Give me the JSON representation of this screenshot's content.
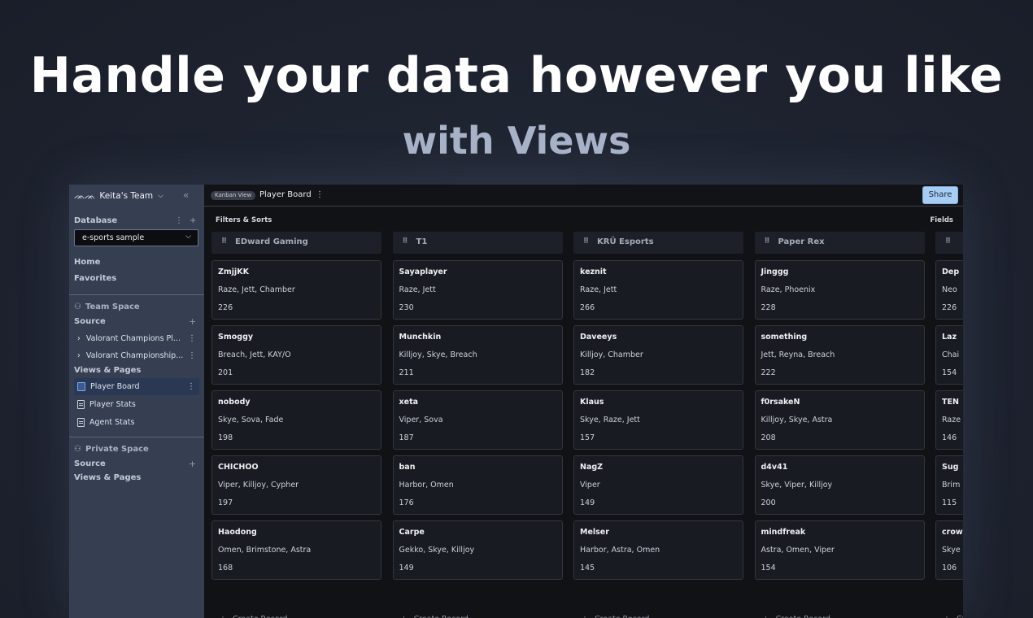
{
  "hero": {
    "title": "Handle your data however you like",
    "subtitle": "with Views"
  },
  "sidebar": {
    "team_name": "Keita's Team",
    "database_label": "Database",
    "database_value": "e-sports sample",
    "home": "Home",
    "favorites": "Favorites",
    "team_space": "Team Space",
    "source_label": "Source",
    "sources": [
      "Valorant Champions Pl...",
      "Valorant Championship..."
    ],
    "views_pages_label": "Views & Pages",
    "views": [
      "Player Board",
      "Player Stats",
      "Agent Stats"
    ],
    "private_space": "Private Space",
    "private_source": "Source",
    "private_views": "Views & Pages"
  },
  "topbar": {
    "view_type": "Kanban View",
    "view_title": "Player Board",
    "share": "Share"
  },
  "toolbar": {
    "filters": "Filters & Sorts",
    "fields": "Fields"
  },
  "board": {
    "create_label": "Create Record",
    "columns": [
      {
        "title": "EDward Gaming",
        "cards": [
          {
            "name": "ZmjjKK",
            "agents": "Raze, Jett, Chamber",
            "value": "226"
          },
          {
            "name": "Smoggy",
            "agents": "Breach, Jett, KAY/O",
            "value": "201"
          },
          {
            "name": "nobody",
            "agents": "Skye, Sova, Fade",
            "value": "198"
          },
          {
            "name": "CHICHOO",
            "agents": "Viper, Killjoy, Cypher",
            "value": "197"
          },
          {
            "name": "Haodong",
            "agents": "Omen, Brimstone, Astra",
            "value": "168"
          }
        ]
      },
      {
        "title": "T1",
        "cards": [
          {
            "name": "Sayaplayer",
            "agents": "Raze, Jett",
            "value": "230"
          },
          {
            "name": "Munchkin",
            "agents": "Killjoy, Skye, Breach",
            "value": "211"
          },
          {
            "name": "xeta",
            "agents": "Viper, Sova",
            "value": "187"
          },
          {
            "name": "ban",
            "agents": "Harbor, Omen",
            "value": "176"
          },
          {
            "name": "Carpe",
            "agents": "Gekko, Skye, Killjoy",
            "value": "149"
          }
        ]
      },
      {
        "title": "KRÜ Esports",
        "cards": [
          {
            "name": "keznit",
            "agents": "Raze, Jett",
            "value": "266"
          },
          {
            "name": "Daveeys",
            "agents": "Killjoy, Chamber",
            "value": "182"
          },
          {
            "name": "Klaus",
            "agents": "Skye, Raze, Jett",
            "value": "157"
          },
          {
            "name": "NagZ",
            "agents": "Viper",
            "value": "149"
          },
          {
            "name": "Melser",
            "agents": "Harbor, Astra, Omen",
            "value": "145"
          }
        ]
      },
      {
        "title": "Paper Rex",
        "cards": [
          {
            "name": "Jinggg",
            "agents": "Raze, Phoenix",
            "value": "228"
          },
          {
            "name": "something",
            "agents": "Jett, Reyna, Breach",
            "value": "222"
          },
          {
            "name": "f0rsakeN",
            "agents": "Killjoy, Skye, Astra",
            "value": "208"
          },
          {
            "name": "d4v41",
            "agents": "Skye, Viper, Killjoy",
            "value": "200"
          },
          {
            "name": "mindfreak",
            "agents": "Astra, Omen, Viper",
            "value": "154"
          }
        ]
      },
      {
        "title": "",
        "cards": [
          {
            "name": "Dep",
            "agents": "Neo",
            "value": "226"
          },
          {
            "name": "Laz",
            "agents": "Chai",
            "value": "154"
          },
          {
            "name": "TEN",
            "agents": "Raze",
            "value": "146"
          },
          {
            "name": "Sug",
            "agents": "Brim",
            "value": "115"
          },
          {
            "name": "crow",
            "agents": "Skye",
            "value": "106"
          }
        ]
      }
    ]
  }
}
